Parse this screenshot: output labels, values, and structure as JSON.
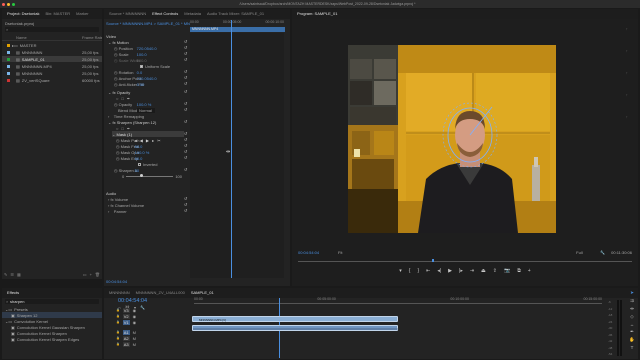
{
  "window": {
    "title": "/Users/saintsaul/Dropbox/arch/MONTAZH MASTERDESK/zaps/WebPost_2022-09-28/Dsetoniak Jadwiga.prproj *"
  },
  "project_panel": {
    "tabs": [
      "Project: Dsetoniak",
      "Bin: MASTER",
      "Marker",
      "Libraries"
    ],
    "breadcrumb": "Dsetoniak.prproj",
    "search_placeholder": "",
    "header_name": "Name",
    "header_rate": "Frame Rate",
    "items": [
      {
        "name": "MASTER",
        "rate": "",
        "color": "#e0a000"
      },
      {
        "name": "MNNNNNN",
        "rate": "25,00 fps",
        "color": "#7bb5e8"
      },
      {
        "name": "SAMPLE_01",
        "rate": "25,00 fps",
        "color": "#22a03a"
      },
      {
        "name": "MNNNNNN.MP4",
        "rate": "25,00 fps",
        "color": "#7bb5e8"
      },
      {
        "name": "MNNNNNN",
        "rate": "25,00 fps",
        "color": "#7bb5e8"
      },
      {
        "name": "ZV_vertSQuare",
        "rate": "60000 fps",
        "color": "#cc3333"
      }
    ]
  },
  "effect_controls": {
    "tabs": [
      "Source * MNNNNNN",
      "Effect Controls",
      "Metadata",
      "Audio Track Mixer: SAMPLE_01"
    ],
    "source_line": "Source * MNNNNNN.MP4 > SAMPLE_01 * MN",
    "ruler_start": "00:00",
    "ruler_mid": "00:00:05:00",
    "ruler_end": "00:00:10:00",
    "clip_name": "MNNNNNN.MP4",
    "sections": {
      "video": "Video",
      "motion": "Motion",
      "opacity": "Opacity",
      "time_remapping": "Time Remapping",
      "sharpen": "Sharpen (Sharpen 12)",
      "audio": "Audio",
      "volume": "Volume",
      "channel_volume": "Channel Volume",
      "panner": "Panner"
    },
    "props": {
      "position": {
        "label": "Position",
        "v1": "720.0",
        "v2": "540.0"
      },
      "scale": {
        "label": "Scale",
        "v1": "100.0"
      },
      "scale_width": {
        "label": "Scale Width",
        "v1": "100.0"
      },
      "uniform_scale": "Uniform Scale",
      "rotation": {
        "label": "Rotation",
        "v1": "0.0"
      },
      "anchor": {
        "label": "Anchor Point",
        "v1": "720.0",
        "v2": "540.0"
      },
      "anti_flicker": {
        "label": "Anti-flicker Filt",
        "v1": "0.00"
      },
      "opacity_val": {
        "label": "Opacity",
        "v1": "100.0 %"
      },
      "blend": {
        "label": "Blend Mode",
        "v1": "Normal"
      },
      "mask": "Mask (1)",
      "mask_path": {
        "label": "Mask Path"
      },
      "mask_feather": {
        "label": "Mask Feat",
        "v1": "50.0"
      },
      "mask_opacity": {
        "label": "Mask Opa",
        "v1": "100.0 %"
      },
      "mask_expansion": {
        "label": "Mask Exp",
        "v1": "50.0"
      },
      "inverted": "Inverted",
      "sharpen_amount": {
        "label": "Sharpen A",
        "v1": "50"
      },
      "slider_min": "0",
      "slider_max": "100"
    },
    "timecode": "00:04:54:04"
  },
  "program_monitor": {
    "tab": "Program: SAMPLE_01",
    "timecode": "00:04:54:04",
    "fit": "Fit",
    "quality": "Full",
    "duration": "00:11:30:06"
  },
  "effects_panel": {
    "tab": "Effects",
    "search_value": "sharpen",
    "tree": [
      {
        "label": "Presets",
        "depth": 0
      },
      {
        "label": "Sharpen 12",
        "depth": 1
      },
      {
        "label": "Convolution Kernel",
        "depth": 0
      },
      {
        "label": "Convolution Kernel Gaussian Sharpen",
        "depth": 1
      },
      {
        "label": "Convolution Kernel Sharpen",
        "depth": 1
      },
      {
        "label": "Convolution Kernel Sharpen Edges",
        "depth": 1
      }
    ]
  },
  "timeline": {
    "tabs": [
      "MNNNNNN",
      "MNNNNNN_ZV_U4ALL000",
      "SAMPLE_01"
    ],
    "timecode": "00:04:54:04",
    "ruler": [
      "00:00",
      "00:05:00:00",
      "00:10:00:00",
      "00:15:00:00"
    ],
    "tracks": [
      "V3",
      "V2",
      "V1",
      "A1",
      "A2",
      "A3"
    ],
    "clip_video": "MNNNNNN.MP4 [V]",
    "clip_audio": "",
    "meter_labels": [
      "-6",
      "-12",
      "-18",
      "-24",
      "-30",
      "-36",
      "-42",
      "-48",
      "-54"
    ]
  },
  "colors": {
    "accent": "#4a8fe0",
    "playhead": "#4a8fe0",
    "wall": "#d9a21e"
  }
}
